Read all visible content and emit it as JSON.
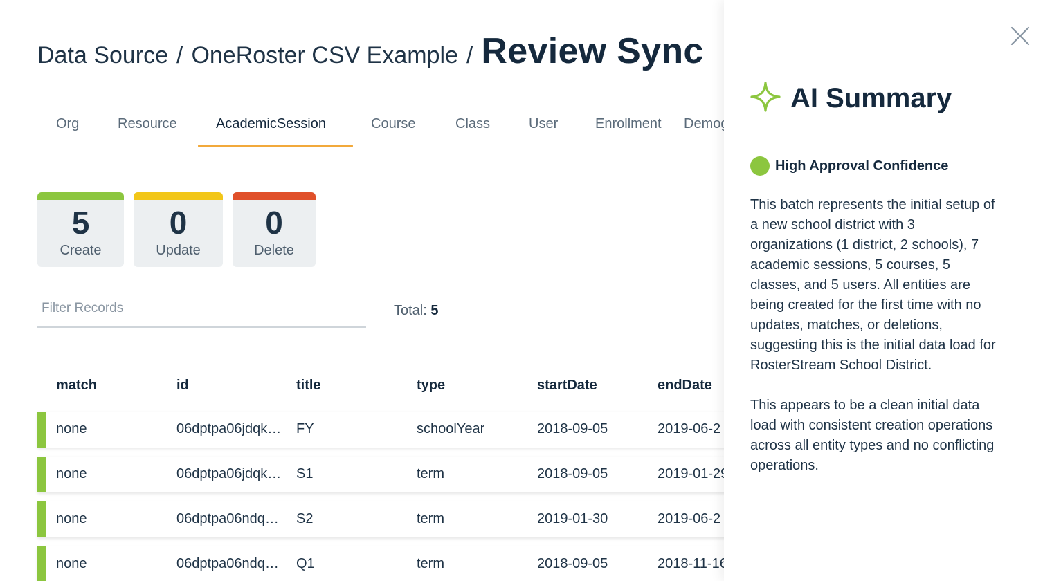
{
  "breadcrumb": {
    "part1": "Data Source",
    "separator": "/",
    "part2": "OneRoster CSV Example",
    "current": "Review Sync"
  },
  "tabs": [
    "Org",
    "Resource",
    "AcademicSession",
    "Course",
    "Class",
    "User",
    "Enrollment",
    "Demographics"
  ],
  "active_tab": "AcademicSession",
  "stats": {
    "create": {
      "value": "5",
      "label": "Create",
      "color": "#8cc63f"
    },
    "update": {
      "value": "0",
      "label": "Update",
      "color": "#f2c618"
    },
    "delete": {
      "value": "0",
      "label": "Delete",
      "color": "#e0502a"
    }
  },
  "filter": {
    "placeholder": "Filter Records",
    "value": ""
  },
  "total": {
    "label": "Total:",
    "value": "5"
  },
  "table": {
    "columns": [
      "match",
      "id",
      "title",
      "type",
      "startDate",
      "endDate"
    ],
    "rows": [
      [
        "none",
        "06dptpa06jdqk…",
        "FY",
        "schoolYear",
        "2018-09-05",
        "2019-06-2"
      ],
      [
        "none",
        "06dptpa06jdqk…",
        "S1",
        "term",
        "2018-09-05",
        "2019-01-29"
      ],
      [
        "none",
        "06dptpa06ndq…",
        "S2",
        "term",
        "2019-01-30",
        "2019-06-2"
      ],
      [
        "none",
        "06dptpa06ndq…",
        "Q1",
        "term",
        "2018-09-05",
        "2018-11-16"
      ]
    ]
  },
  "ai_panel": {
    "title": "AI Summary",
    "confidence": "High Approval Confidence",
    "paragraph1": "This batch represents the initial setup of a new school district with 3 organizations (1 district, 2 schools), 7 academic sessions, 5 courses, 5 classes, and 5 users. All entities are being created for the first time with no updates, matches, or deletions, suggesting this is the initial data load for RosterStream School District.",
    "paragraph2": "This appears to be a clean initial data load with consistent creation operations across all entity types and no conflicting operations.",
    "colors": {
      "accent": "#8cc63f",
      "text": "#15293d"
    }
  }
}
